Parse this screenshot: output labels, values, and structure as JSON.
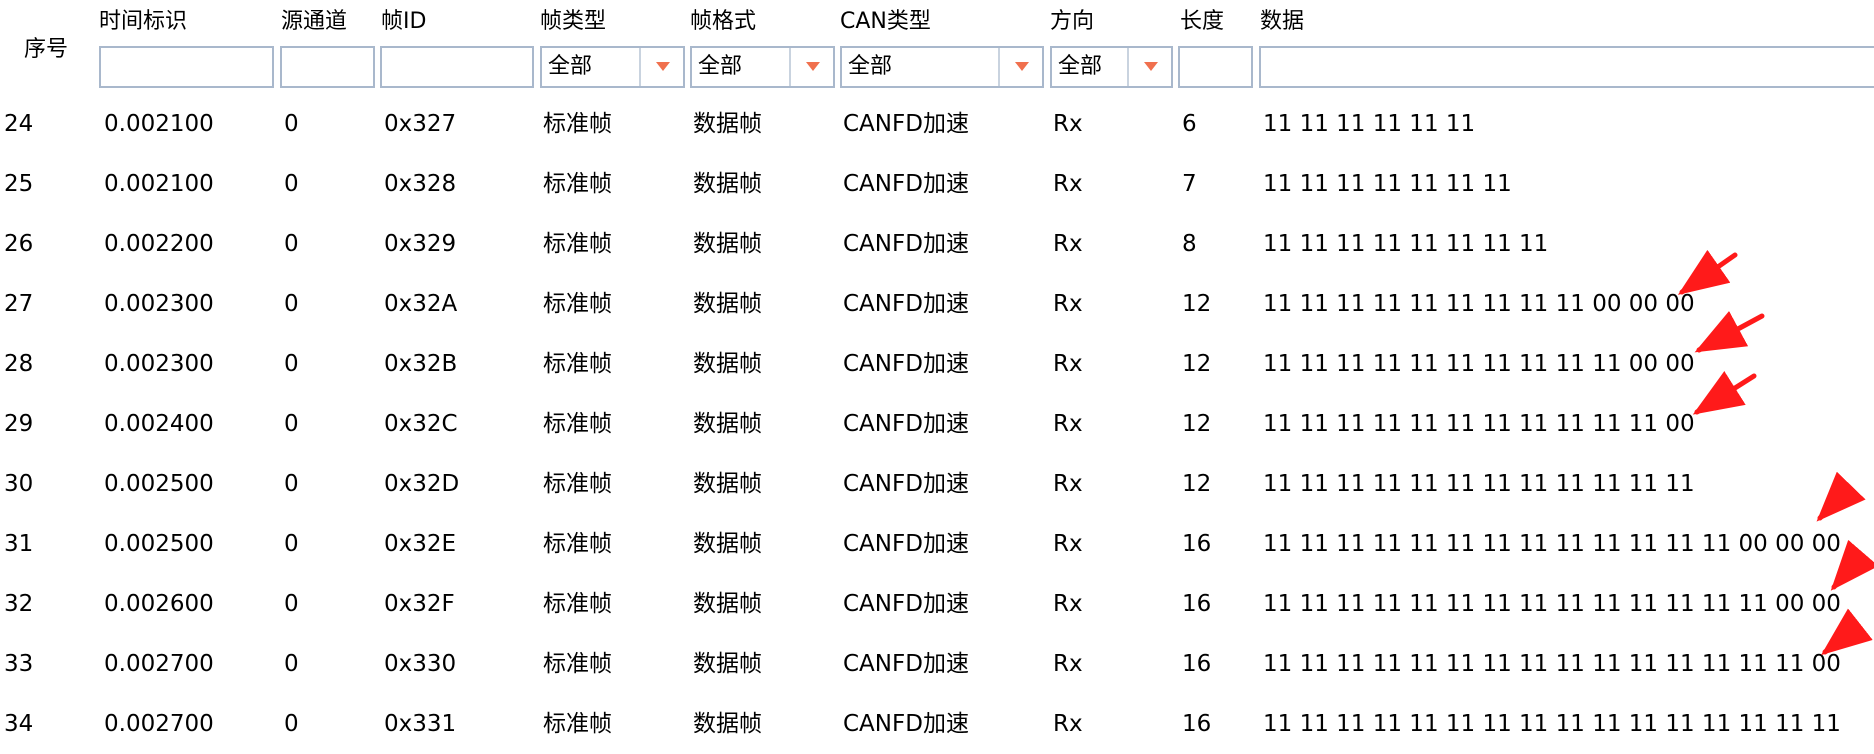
{
  "columns": {
    "seq": "序号",
    "time": "时间标识",
    "channel": "源通道",
    "frame_id": "帧ID",
    "frame_type": "帧类型",
    "frame_format": "帧格式",
    "can_type": "CAN类型",
    "direction": "方向",
    "length": "长度",
    "data": "数据"
  },
  "filters": {
    "frame_type": "全部",
    "frame_format": "全部",
    "can_type": "全部",
    "direction": "全部"
  },
  "rows": [
    {
      "seq": "24",
      "time": "0.002100",
      "ch": "0",
      "id": "0x327",
      "type": "标准帧",
      "format": "数据帧",
      "can": "CANFD加速",
      "dir": "Rx",
      "len": "6",
      "data": "11 11 11 11 11 11"
    },
    {
      "seq": "25",
      "time": "0.002100",
      "ch": "0",
      "id": "0x328",
      "type": "标准帧",
      "format": "数据帧",
      "can": "CANFD加速",
      "dir": "Rx",
      "len": "7",
      "data": "11 11 11 11 11 11 11"
    },
    {
      "seq": "26",
      "time": "0.002200",
      "ch": "0",
      "id": "0x329",
      "type": "标准帧",
      "format": "数据帧",
      "can": "CANFD加速",
      "dir": "Rx",
      "len": "8",
      "data": "11 11 11 11 11 11 11 11"
    },
    {
      "seq": "27",
      "time": "0.002300",
      "ch": "0",
      "id": "0x32A",
      "type": "标准帧",
      "format": "数据帧",
      "can": "CANFD加速",
      "dir": "Rx",
      "len": "12",
      "data": "11 11 11 11 11 11 11 11 11 00 00 00"
    },
    {
      "seq": "28",
      "time": "0.002300",
      "ch": "0",
      "id": "0x32B",
      "type": "标准帧",
      "format": "数据帧",
      "can": "CANFD加速",
      "dir": "Rx",
      "len": "12",
      "data": "11 11 11 11 11 11 11 11 11 11 00 00"
    },
    {
      "seq": "29",
      "time": "0.002400",
      "ch": "0",
      "id": "0x32C",
      "type": "标准帧",
      "format": "数据帧",
      "can": "CANFD加速",
      "dir": "Rx",
      "len": "12",
      "data": "11 11 11 11 11 11 11 11 11 11 11 00"
    },
    {
      "seq": "30",
      "time": "0.002500",
      "ch": "0",
      "id": "0x32D",
      "type": "标准帧",
      "format": "数据帧",
      "can": "CANFD加速",
      "dir": "Rx",
      "len": "12",
      "data": "11 11 11 11 11 11 11 11 11 11 11 11"
    },
    {
      "seq": "31",
      "time": "0.002500",
      "ch": "0",
      "id": "0x32E",
      "type": "标准帧",
      "format": "数据帧",
      "can": "CANFD加速",
      "dir": "Rx",
      "len": "16",
      "data": "11 11 11 11 11 11 11 11 11 11 11 11 11 00 00 00"
    },
    {
      "seq": "32",
      "time": "0.002600",
      "ch": "0",
      "id": "0x32F",
      "type": "标准帧",
      "format": "数据帧",
      "can": "CANFD加速",
      "dir": "Rx",
      "len": "16",
      "data": "11 11 11 11 11 11 11 11 11 11 11 11 11 11 00 00"
    },
    {
      "seq": "33",
      "time": "0.002700",
      "ch": "0",
      "id": "0x330",
      "type": "标准帧",
      "format": "数据帧",
      "can": "CANFD加速",
      "dir": "Rx",
      "len": "16",
      "data": "11 11 11 11 11 11 11 11 11 11 11 11 11 11 11 00"
    },
    {
      "seq": "34",
      "time": "0.002700",
      "ch": "0",
      "id": "0x331",
      "type": "标准帧",
      "format": "数据帧",
      "can": "CANFD加速",
      "dir": "Rx",
      "len": "16",
      "data": "11 11 11 11 11 11 11 11 11 11 11 11 11 11 11 11"
    }
  ],
  "annotation_color": "#ff1a1a",
  "annotations": [
    "red-arrow",
    "red-arrow",
    "red-arrow",
    "red-arrow",
    "red-arrow",
    "red-arrow"
  ]
}
